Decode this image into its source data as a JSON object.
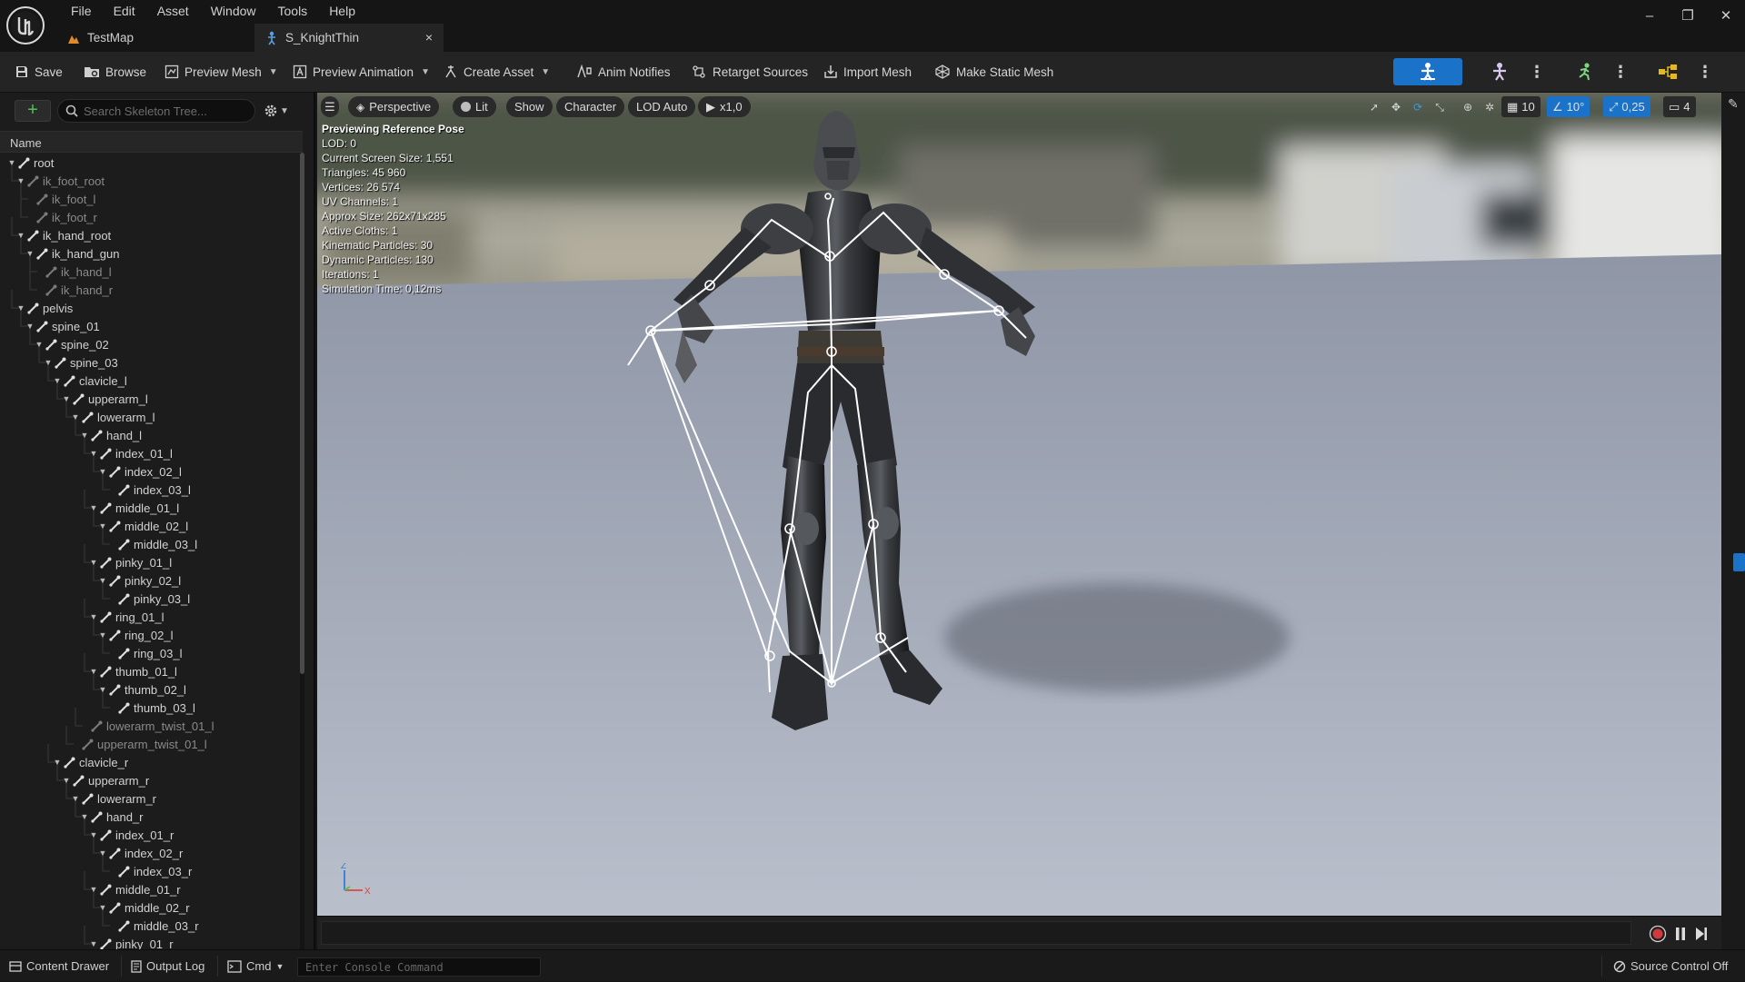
{
  "menu": [
    "File",
    "Edit",
    "Asset",
    "Window",
    "Tools",
    "Help"
  ],
  "tabs": [
    {
      "label": "TestMap",
      "active": false
    },
    {
      "label": "S_KnightThin",
      "active": true,
      "close": "×"
    }
  ],
  "window_controls": [
    "–",
    "❐",
    "✕"
  ],
  "toolbar": {
    "save": "Save",
    "browse": "Browse",
    "preview_mesh": "Preview Mesh",
    "preview_animation": "Preview Animation",
    "create_asset": "Create Asset",
    "anim_notifies": "Anim Notifies",
    "retarget_sources": "Retarget Sources",
    "import_mesh": "Import Mesh",
    "make_static_mesh": "Make Static Mesh"
  },
  "skeleton_panel": {
    "search_placeholder": "Search Skeleton Tree...",
    "column_header": "Name",
    "bones": [
      {
        "name": "root",
        "depth": 0,
        "dim": false,
        "arrow": true
      },
      {
        "name": "ik_foot_root",
        "depth": 1,
        "dim": true,
        "arrow": true
      },
      {
        "name": "ik_foot_l",
        "depth": 2,
        "dim": true,
        "arrow": false
      },
      {
        "name": "ik_foot_r",
        "depth": 2,
        "dim": true,
        "arrow": false
      },
      {
        "name": "ik_hand_root",
        "depth": 1,
        "dim": false,
        "arrow": true
      },
      {
        "name": "ik_hand_gun",
        "depth": 2,
        "dim": false,
        "arrow": true
      },
      {
        "name": "ik_hand_l",
        "depth": 3,
        "dim": true,
        "arrow": false
      },
      {
        "name": "ik_hand_r",
        "depth": 3,
        "dim": true,
        "arrow": false
      },
      {
        "name": "pelvis",
        "depth": 1,
        "dim": false,
        "arrow": true
      },
      {
        "name": "spine_01",
        "depth": 2,
        "dim": false,
        "arrow": true
      },
      {
        "name": "spine_02",
        "depth": 3,
        "dim": false,
        "arrow": true
      },
      {
        "name": "spine_03",
        "depth": 4,
        "dim": false,
        "arrow": true
      },
      {
        "name": "clavicle_l",
        "depth": 5,
        "dim": false,
        "arrow": true
      },
      {
        "name": "upperarm_l",
        "depth": 6,
        "dim": false,
        "arrow": true
      },
      {
        "name": "lowerarm_l",
        "depth": 7,
        "dim": false,
        "arrow": true
      },
      {
        "name": "hand_l",
        "depth": 8,
        "dim": false,
        "arrow": true
      },
      {
        "name": "index_01_l",
        "depth": 9,
        "dim": false,
        "arrow": true
      },
      {
        "name": "index_02_l",
        "depth": 10,
        "dim": false,
        "arrow": true
      },
      {
        "name": "index_03_l",
        "depth": 11,
        "dim": false,
        "arrow": false
      },
      {
        "name": "middle_01_l",
        "depth": 9,
        "dim": false,
        "arrow": true
      },
      {
        "name": "middle_02_l",
        "depth": 10,
        "dim": false,
        "arrow": true
      },
      {
        "name": "middle_03_l",
        "depth": 11,
        "dim": false,
        "arrow": false
      },
      {
        "name": "pinky_01_l",
        "depth": 9,
        "dim": false,
        "arrow": true
      },
      {
        "name": "pinky_02_l",
        "depth": 10,
        "dim": false,
        "arrow": true
      },
      {
        "name": "pinky_03_l",
        "depth": 11,
        "dim": false,
        "arrow": false
      },
      {
        "name": "ring_01_l",
        "depth": 9,
        "dim": false,
        "arrow": true
      },
      {
        "name": "ring_02_l",
        "depth": 10,
        "dim": false,
        "arrow": true
      },
      {
        "name": "ring_03_l",
        "depth": 11,
        "dim": false,
        "arrow": false
      },
      {
        "name": "thumb_01_l",
        "depth": 9,
        "dim": false,
        "arrow": true
      },
      {
        "name": "thumb_02_l",
        "depth": 10,
        "dim": false,
        "arrow": true
      },
      {
        "name": "thumb_03_l",
        "depth": 11,
        "dim": false,
        "arrow": false
      },
      {
        "name": "lowerarm_twist_01_l",
        "depth": 8,
        "dim": true,
        "arrow": false
      },
      {
        "name": "upperarm_twist_01_l",
        "depth": 7,
        "dim": true,
        "arrow": false
      },
      {
        "name": "clavicle_r",
        "depth": 5,
        "dim": false,
        "arrow": true
      },
      {
        "name": "upperarm_r",
        "depth": 6,
        "dim": false,
        "arrow": true
      },
      {
        "name": "lowerarm_r",
        "depth": 7,
        "dim": false,
        "arrow": true
      },
      {
        "name": "hand_r",
        "depth": 8,
        "dim": false,
        "arrow": true
      },
      {
        "name": "index_01_r",
        "depth": 9,
        "dim": false,
        "arrow": true
      },
      {
        "name": "index_02_r",
        "depth": 10,
        "dim": false,
        "arrow": true
      },
      {
        "name": "index_03_r",
        "depth": 11,
        "dim": false,
        "arrow": false
      },
      {
        "name": "middle_01_r",
        "depth": 9,
        "dim": false,
        "arrow": true
      },
      {
        "name": "middle_02_r",
        "depth": 10,
        "dim": false,
        "arrow": true
      },
      {
        "name": "middle_03_r",
        "depth": 11,
        "dim": false,
        "arrow": false
      },
      {
        "name": "pinky_01_r",
        "depth": 9,
        "dim": false,
        "arrow": true
      }
    ]
  },
  "viewport": {
    "perspective": "Perspective",
    "lit": "Lit",
    "show": "Show",
    "character": "Character",
    "lod": "LOD Auto",
    "play_rate": "x1,0",
    "grid_snap": "10",
    "rot_snap": "10°",
    "scale_snap": "0,25",
    "camera_speed": "4",
    "stats": [
      "Previewing Reference Pose",
      "LOD: 0",
      "Current Screen Size: 1,551",
      "Triangles: 45 960",
      "Vertices: 26 574",
      "UV Channels: 1",
      "Approx Size: 262x71x285",
      "Active Cloths: 1",
      "Kinematic Particles: 30",
      "Dynamic Particles: 130",
      "Iterations: 1",
      "Simulation Time: 0,12ms"
    ],
    "axis_z": "Z",
    "axis_x": "X"
  },
  "statusbar": {
    "content_drawer": "Content Drawer",
    "output_log": "Output Log",
    "cmd": "Cmd",
    "console_placeholder": "Enter Console Command",
    "source_control": "Source Control Off"
  },
  "colors": {
    "accent": "#1a72c9",
    "record": "#d03a3a",
    "add": "#4cc54c"
  }
}
